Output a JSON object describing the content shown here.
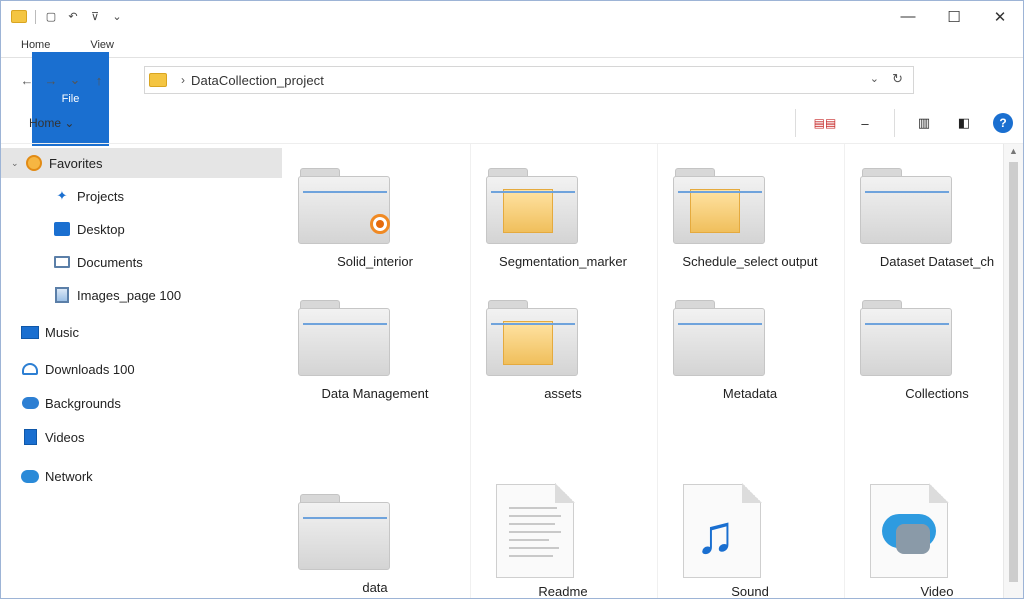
{
  "titlebar": {
    "quick_access": [
      "save-icon",
      "undo-icon",
      "pin-icon",
      "chevron-down-icon"
    ],
    "controls": {
      "minimize": "—",
      "maximize": "☐",
      "close": "✕"
    }
  },
  "tabs": [
    {
      "label": "File",
      "active": true
    },
    {
      "label": "Home",
      "active": false
    },
    {
      "label": "View",
      "active": false
    }
  ],
  "address": {
    "path": "DataCollection_project",
    "chevron": "›",
    "dropdown": "⌄",
    "refresh": "↻"
  },
  "nav": {
    "back": "←",
    "forward": "→",
    "recent": "⌄",
    "up": "↑"
  },
  "cmdbar": {
    "home_dropdown": "Home",
    "view_label": "View",
    "help": "?"
  },
  "sidebar": {
    "items": [
      {
        "label": "Favorites",
        "icon": "star-icon",
        "expanded": true,
        "selected": true
      },
      {
        "label": "Projects",
        "icon": "quick-access-arrow-icon"
      },
      {
        "label": "Desktop",
        "icon": "desktop-icon"
      },
      {
        "label": "Documents",
        "icon": "documents-icon"
      },
      {
        "label": "Images_page 100",
        "icon": "pictures-icon"
      },
      {
        "label": "Music",
        "icon": "monitor-icon"
      },
      {
        "label": "Downloads 100",
        "icon": "network-icon"
      },
      {
        "label": "Backgrounds",
        "icon": "cloud-icon"
      },
      {
        "label": "Videos",
        "icon": "video-icon"
      },
      {
        "label": "Network",
        "icon": "chat-bubble-icon"
      }
    ]
  },
  "items": [
    {
      "name": "Solid_interior",
      "type": "folder",
      "variant": "badge"
    },
    {
      "name": "Segmentation_marker",
      "type": "folder",
      "variant": "paper"
    },
    {
      "name": "Schedule_select output",
      "type": "folder",
      "variant": "paper"
    },
    {
      "name": "Dataset Dataset_ch",
      "type": "folder",
      "variant": "plain"
    },
    {
      "name": "Data Management",
      "type": "folder",
      "variant": "plain"
    },
    {
      "name": "assets",
      "type": "folder",
      "variant": "paper"
    },
    {
      "name": "Metadata",
      "type": "folder",
      "variant": "plain"
    },
    {
      "name": "Collections",
      "type": "folder",
      "variant": "plain"
    },
    {
      "name": "data",
      "type": "folder",
      "variant": "plain"
    },
    {
      "name": "Readme",
      "type": "document"
    },
    {
      "name": "Sound",
      "type": "audio"
    },
    {
      "name": "Video",
      "type": "video"
    }
  ]
}
